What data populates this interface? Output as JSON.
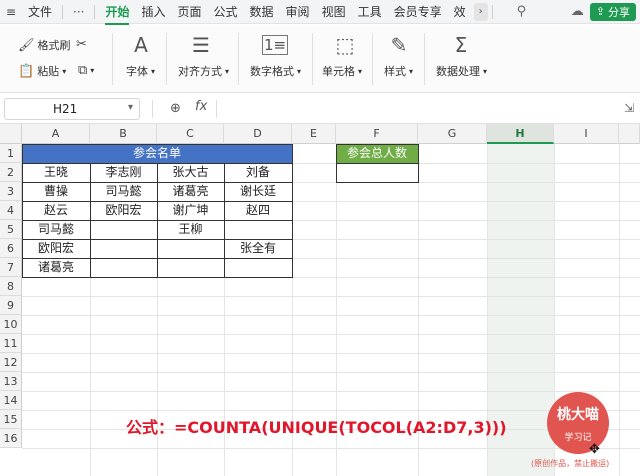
{
  "menubar": {
    "file": "文件",
    "more": "···",
    "tabs": [
      "开始",
      "插入",
      "页面",
      "公式",
      "数据",
      "审阅",
      "视图",
      "工具",
      "会员专享",
      "效"
    ],
    "active_tab": "开始",
    "share": "分享"
  },
  "ribbon": {
    "format_painter": "格式刷",
    "paste": "粘贴",
    "font": "字体",
    "alignment": "对齐方式",
    "number_format": "数字格式",
    "cells": "单元格",
    "styles": "样式",
    "data_processing": "数据处理"
  },
  "formula_bar": {
    "name_box": "H21",
    "fx": "fx",
    "value": ""
  },
  "sheet": {
    "columns": [
      "A",
      "B",
      "C",
      "D",
      "E",
      "F",
      "G",
      "H",
      "I"
    ],
    "selected_column": "H",
    "rows": [
      "1",
      "2",
      "3",
      "4",
      "5",
      "6",
      "7",
      "8",
      "9",
      "10",
      "11",
      "12",
      "13",
      "14",
      "15",
      "16"
    ],
    "table_title": "参会名单",
    "names": [
      [
        "王晓",
        "李志刚",
        "张大古",
        "刘备"
      ],
      [
        "曹操",
        "司马懿",
        "诸葛亮",
        "谢长廷"
      ],
      [
        "赵云",
        "欧阳宏",
        "谢广坤",
        "赵四"
      ],
      [
        "司马懿",
        "",
        "王柳",
        ""
      ],
      [
        "欧阳宏",
        "",
        "",
        "张全有"
      ],
      [
        "诸葛亮",
        "",
        "",
        ""
      ]
    ],
    "count_title": "参会总人数",
    "count_value": ""
  },
  "annotation": {
    "formula": "公式：=COUNTA(UNIQUE(TOCOL(A2:D7,3)))"
  },
  "watermark": {
    "line1": "桃大喵",
    "line2": "学习记",
    "note": "(原创作品，禁止搬运)"
  },
  "colors": {
    "accent": "#1e9a52",
    "table_title_bg": "#4472c4",
    "count_title_bg": "#70ad47",
    "formula_text": "#e0162b"
  }
}
